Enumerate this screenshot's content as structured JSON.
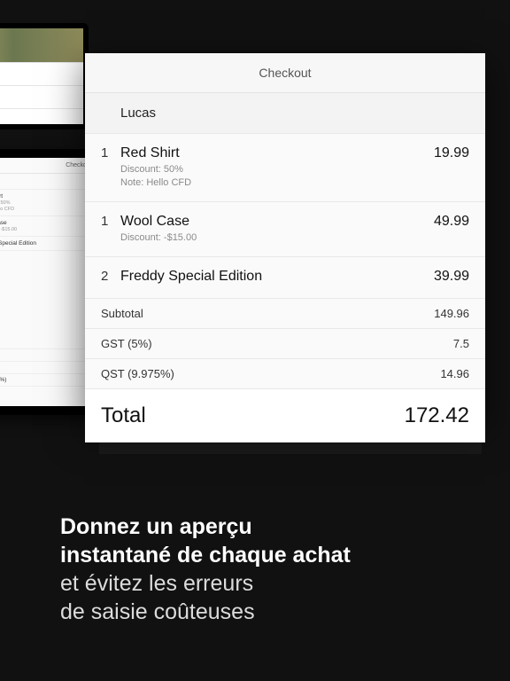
{
  "checkout": {
    "header": "Checkout",
    "customer": "Lucas",
    "items": [
      {
        "qty": "1",
        "name": "Red Shirt",
        "sub1": "Discount: 50%",
        "sub2": "Note: Hello CFD",
        "price": "19.99"
      },
      {
        "qty": "1",
        "name": "Wool Case",
        "sub1": "Discount: -$15.00",
        "sub2": "",
        "price": "49.99"
      },
      {
        "qty": "2",
        "name": "Freddy Special Edition",
        "sub1": "",
        "sub2": "",
        "price": "39.99"
      }
    ],
    "summary": [
      {
        "label": "Subtotal",
        "value": "149.96"
      },
      {
        "label": "GST (5%)",
        "value": "7.5"
      },
      {
        "label": "QST (9.975%)",
        "value": "14.96"
      }
    ],
    "total_label": "Total",
    "total_value": "172.42"
  },
  "caption": {
    "line1": "Donnez un aperçu",
    "line2": "instantané de chaque achat",
    "line3": "et évitez les erreurs",
    "line4": "de saisie coûteuses"
  }
}
